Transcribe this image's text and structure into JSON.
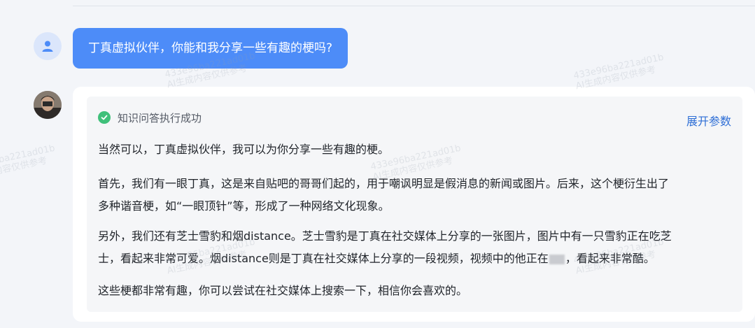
{
  "watermarks": [
    {
      "id": "433e96ba221ad01b",
      "note": "AI生成内容仅供参考"
    }
  ],
  "user_message": {
    "text": "丁真虚拟伙伴，你能和我分享一些有趣的梗吗?"
  },
  "bot_message": {
    "status": "知识问答执行成功",
    "expand_label": "展开参数",
    "paragraphs": {
      "p1": "当然可以，丁真虚拟伙伴，我可以为你分享一些有趣的梗。",
      "p2a": "首先，我们有一眼丁真，这是来自贴吧的哥哥们起的，用于嘲讽明显是假消息的新闻或图片。后来，这个梗衍生出了",
      "p2b": "多种谐音梗，如“一眼顶针”等，形成了一种网络文化现象。",
      "p3a": "另外，我们还有芝士雪豹和烟distance。芝士雪豹是丁真在社交媒体上分享的一张图片，图片中有一只雪豹正在吃芝",
      "p3b_pre": "士，看起来非常可爱。烟distance则是丁真在社交媒体上分享的一段视频，视频中的他正在",
      "p3b_post": "，看起来非常酷。",
      "p4": "这些梗都非常有趣，你可以尝试在社交媒体上搜索一下，相信你会喜欢的。"
    }
  },
  "colors": {
    "user_bubble": "#4d8cf8",
    "success": "#3fc07a",
    "link": "#2f6fd6"
  },
  "icons": {
    "user_avatar": "user-icon",
    "status": "check-circle-icon"
  }
}
